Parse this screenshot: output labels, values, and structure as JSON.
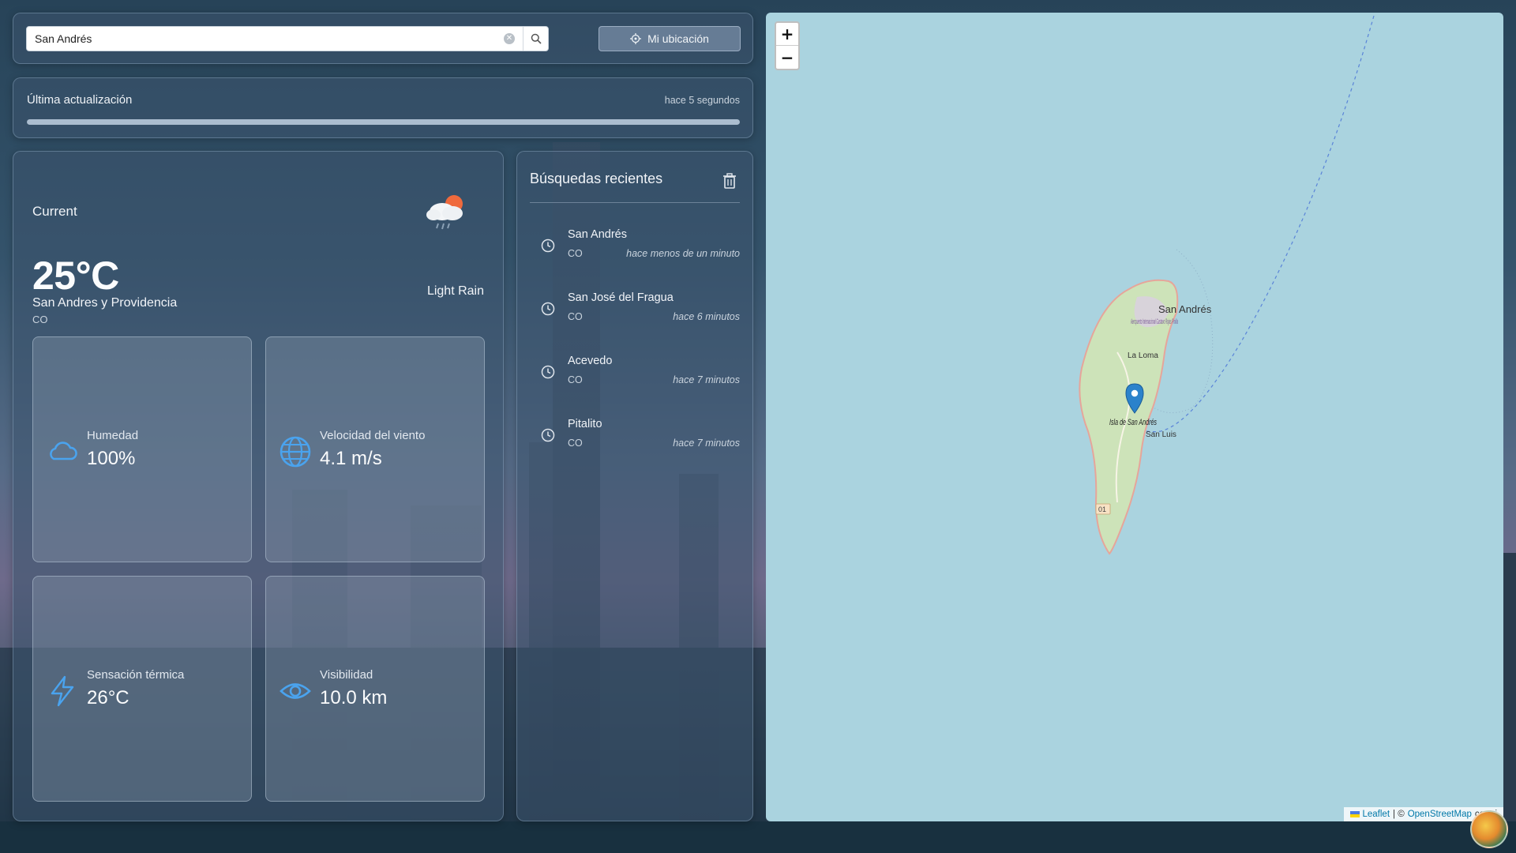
{
  "search": {
    "value": "San Andrés",
    "placeholder": "",
    "clear_icon": "clear-circle-icon",
    "search_icon": "search-icon"
  },
  "location_button": {
    "label": "Mi ubicación",
    "icon": "crosshair-icon"
  },
  "update": {
    "label": "Última actualización",
    "time": "hace 5 segundos",
    "progress": 1.0
  },
  "current": {
    "label": "Current",
    "icon": "cloud-rain-sun-icon",
    "temperature": "25°C",
    "condition": "Light Rain",
    "city": "San Andres y Providencia",
    "country": "CO",
    "stats": [
      {
        "label": "Humedad",
        "value": "100%",
        "icon": "cloud-icon"
      },
      {
        "label": "Velocidad del viento",
        "value": "4.1 m/s",
        "icon": "globe-icon"
      },
      {
        "label": "Sensación térmica",
        "value": "26°C",
        "icon": "lightning-icon"
      },
      {
        "label": "Visibilidad",
        "value": "10.0 km",
        "icon": "eye-icon"
      }
    ]
  },
  "recent": {
    "title": "Búsquedas recientes",
    "clear_icon": "trash-icon",
    "items": [
      {
        "name": "San Andrés",
        "country": "CO",
        "time": "hace menos de un minuto"
      },
      {
        "name": "San José del Fragua",
        "country": "CO",
        "time": "hace 6 minutos"
      },
      {
        "name": "Acevedo",
        "country": "CO",
        "time": "hace 7 minutos"
      },
      {
        "name": "Pitalito",
        "country": "CO",
        "time": "hace 7 minutos"
      }
    ]
  },
  "map": {
    "zoom_in": "+",
    "zoom_out": "−",
    "labels": {
      "city": "San Andrés",
      "airport": "Aeropuerto Internacional Gustavo Rojas Pinilla",
      "la_loma": "La Loma",
      "island": "Isla de San Andrés",
      "san_luis": "San Luis",
      "road": "01"
    },
    "attribution": {
      "leaflet": "Leaflet",
      "separator": "| ©",
      "osm": "OpenStreetMap",
      "contrib": "contri"
    },
    "colors": {
      "water": "#aad3df",
      "land": "#cde3b9",
      "marker": "#2b82cb"
    }
  }
}
